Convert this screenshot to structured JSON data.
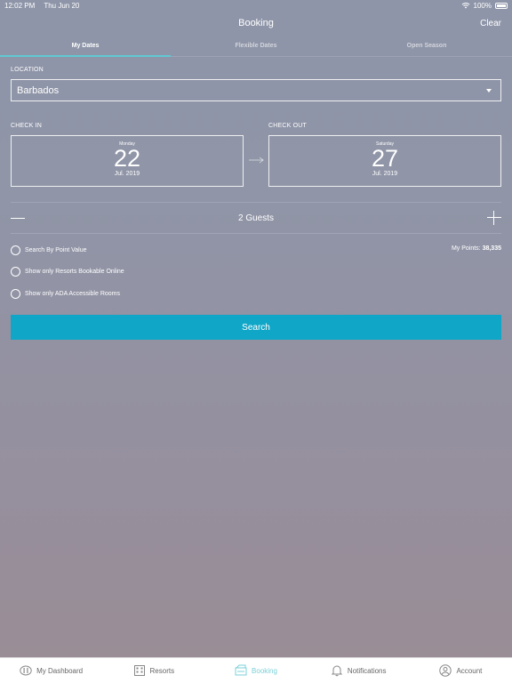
{
  "status": {
    "time": "12:02 PM",
    "date": "Thu Jun 20",
    "battery": "100%"
  },
  "header": {
    "title": "Booking",
    "clear_label": "Clear"
  },
  "tabs": [
    {
      "label": "My Dates",
      "active": true
    },
    {
      "label": "Flexible Dates",
      "active": false
    },
    {
      "label": "Open Season",
      "active": false
    }
  ],
  "location": {
    "label": "LOCATION",
    "value": "Barbados"
  },
  "check_in": {
    "label": "CHECK IN",
    "weekday": "Monday",
    "day": "22",
    "month_year": "Jul. 2019"
  },
  "check_out": {
    "label": "CHECK OUT",
    "weekday": "Saturday",
    "day": "27",
    "month_year": "Jul. 2019"
  },
  "guests": {
    "label": "2 Guests"
  },
  "options": [
    {
      "label": "Search By Point Value"
    },
    {
      "label": "Show only Resorts Bookable Online"
    },
    {
      "label": "Show only ADA Accessible Rooms"
    }
  ],
  "points": {
    "label": "My Points:",
    "value": "38,335"
  },
  "search_label": "Search",
  "tabbar": [
    {
      "label": "My Dashboard",
      "icon": "dashboard-icon"
    },
    {
      "label": "Resorts",
      "icon": "building-icon"
    },
    {
      "label": "Booking",
      "icon": "booking-icon",
      "active": true
    },
    {
      "label": "Notifications",
      "icon": "bell-icon"
    },
    {
      "label": "Account",
      "icon": "user-icon"
    }
  ],
  "colors": {
    "accent": "#0fa6c8",
    "tab_underline": "#5fc9d3",
    "active_tabbar": "#7bd0d8"
  }
}
